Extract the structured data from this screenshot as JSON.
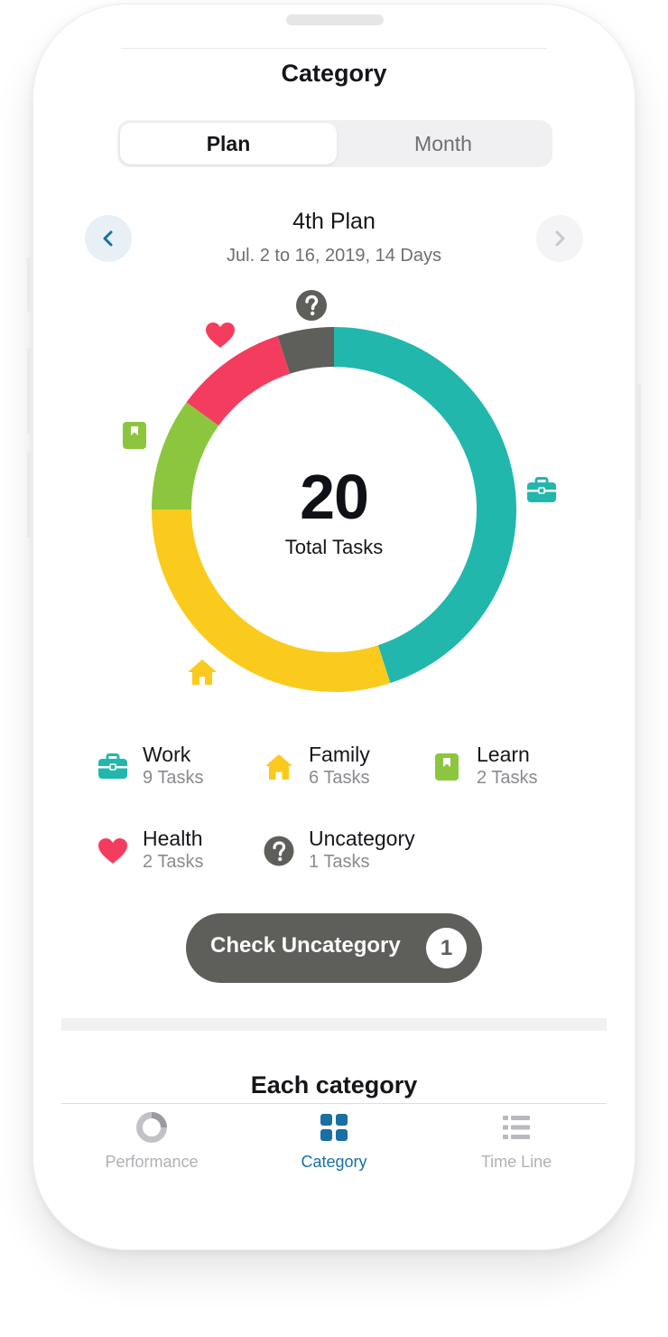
{
  "header": {
    "title": "Category"
  },
  "segmented": {
    "options": [
      "Plan",
      "Month"
    ],
    "selected": "Plan"
  },
  "plan": {
    "name": "4th Plan",
    "range": "Jul. 2 to 16, 2019, 14 Days"
  },
  "chart_data": {
    "type": "pie",
    "center_value": "20",
    "center_label": "Total Tasks",
    "categories": [
      "Work",
      "Family",
      "Learn",
      "Health",
      "Uncategory"
    ],
    "values": [
      9,
      6,
      2,
      2,
      1
    ],
    "colors": [
      "#21b7ad",
      "#facb1c",
      "#8cc63f",
      "#f43d5e",
      "#5e5f5b"
    ]
  },
  "legend": [
    {
      "name": "Work",
      "count": "9 Tasks",
      "icon": "briefcase-icon",
      "color": "#21b7ad"
    },
    {
      "name": "Family",
      "count": "6 Tasks",
      "icon": "house-icon",
      "color": "#facb1c"
    },
    {
      "name": "Learn",
      "count": "2 Tasks",
      "icon": "book-icon",
      "color": "#8cc63f"
    },
    {
      "name": "Health",
      "count": "2 Tasks",
      "icon": "heart-icon",
      "color": "#f43d5e"
    },
    {
      "name": "Uncategory",
      "count": "1 Tasks",
      "icon": "question-icon",
      "color": "#5e5f5b"
    }
  ],
  "check_button": {
    "label": "Check Uncategory",
    "badge": "1"
  },
  "section": {
    "title": "Each category"
  },
  "tabbar": {
    "items": [
      {
        "label": "Performance",
        "icon": "ring-icon",
        "active": false
      },
      {
        "label": "Category",
        "icon": "grid-icon",
        "active": true
      },
      {
        "label": "Time Line",
        "icon": "list-icon",
        "active": false
      }
    ],
    "active_color": "#1a6fa3",
    "inactive_color": "#b0b0b5"
  }
}
